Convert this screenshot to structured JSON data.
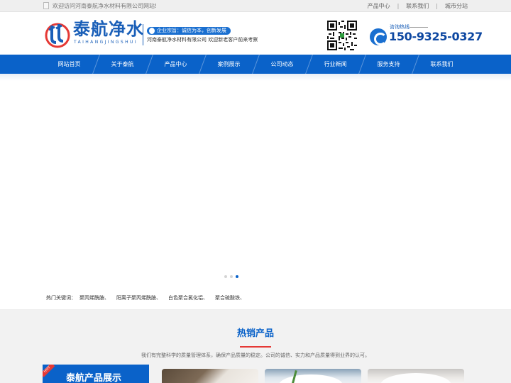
{
  "topbar": {
    "welcome": "欢迎访问河南泰航净水材料有限公司网站!",
    "links": [
      "产品中心",
      "联系我们",
      "城市分站"
    ]
  },
  "header": {
    "brand_name": "泰航净水",
    "brand_pinyin": "TAIHANGJINGSHUI",
    "slogan": "企业宗旨：诚信为本，创新发展",
    "company_tagline": "河南泰航净水材料有限公司 欢迎新老客户前来考察",
    "hotline_label": "咨询热线",
    "hotline_number": "150-9325-0327"
  },
  "nav": {
    "items": [
      "网站首页",
      "关于泰航",
      "产品中心",
      "案例展示",
      "公司动态",
      "行业新闻",
      "服务支持",
      "联系我们"
    ]
  },
  "banner": {
    "slide_count": 3,
    "active_slide": 3
  },
  "keywords": {
    "label": "热门关键词：",
    "items": [
      "聚丙烯酰胺、",
      "阳离子聚丙烯酰胺、",
      "白色聚合氯化铝、",
      "聚合硫酸铁、"
    ]
  },
  "hot_products": {
    "title": "热销产品",
    "description": "我们有完整科学的质量管理体系，确保产品质量的稳定。公司的诚信、实力和产品质量得到业界的认可。",
    "showcase_title": "泰航产品展示",
    "showcase_corner": "HOT"
  },
  "colors": {
    "primary": "#0a62c9",
    "accent_red": "#e53935",
    "brand_text": "#1a5fb8"
  }
}
